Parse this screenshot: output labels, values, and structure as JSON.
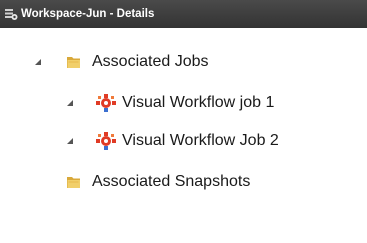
{
  "header": {
    "title": "Workspace-Jun - Details",
    "icon": "workspace-icon"
  },
  "tree": {
    "associated_jobs": {
      "label": "Associated Jobs",
      "icon": "folder-icon",
      "expanded": true,
      "children": [
        {
          "label": "Visual Workflow job 1",
          "icon": "workflow-job-icon",
          "expanded": true
        },
        {
          "label": "Visual Workflow Job 2",
          "icon": "workflow-job-icon",
          "expanded": true
        }
      ]
    },
    "associated_snapshots": {
      "label": "Associated Snapshots",
      "icon": "folder-icon"
    }
  },
  "colors": {
    "header_bg": "#3c3c3c",
    "header_text": "#ffffff",
    "folder": "#e3b84e",
    "workflow_red": "#e03b25",
    "workflow_blue": "#3b6fd0"
  }
}
